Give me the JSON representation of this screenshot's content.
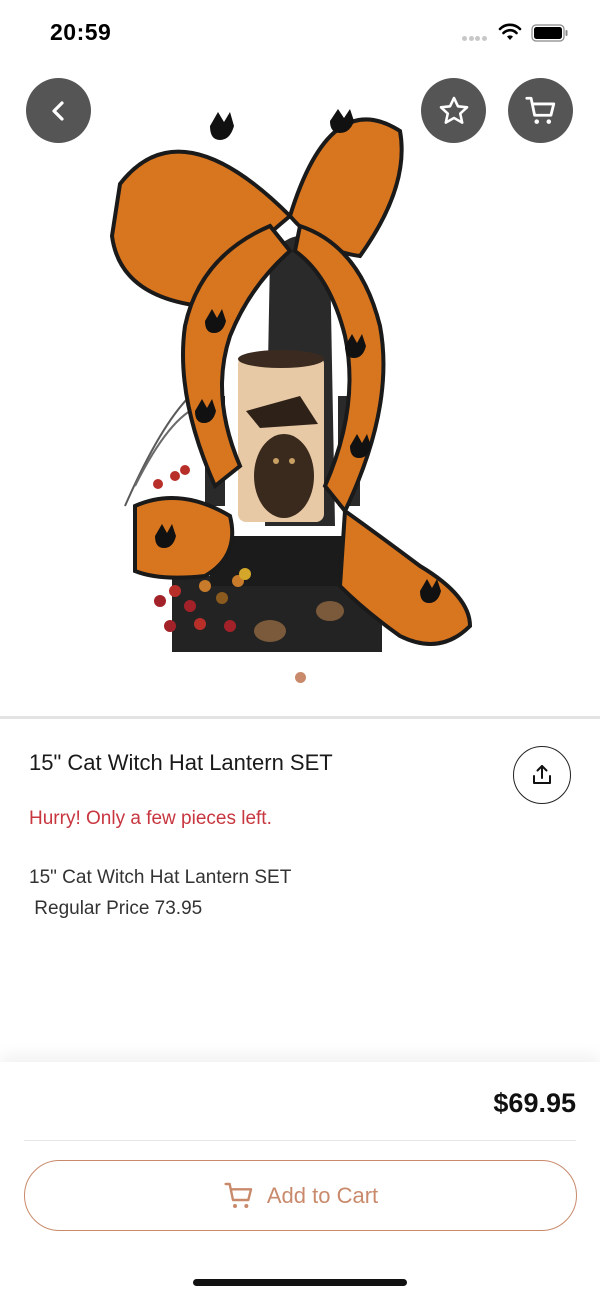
{
  "status_bar": {
    "time": "20:59"
  },
  "product": {
    "title": "15\" Cat Witch Hat Lantern SET",
    "stock_alert": "Hurry! Only a few pieces left.",
    "description": "15\" Cat Witch Hat Lantern SET\n Regular Price 73.95",
    "price": "$69.95",
    "image_count": 1,
    "active_image_index": 0
  },
  "actions": {
    "add_to_cart_label": "Add to Cart"
  },
  "icons": {
    "back": "chevron-left-icon",
    "favorite": "star-icon",
    "cart": "cart-icon",
    "share": "share-icon",
    "add_to_cart": "cart-icon"
  },
  "colors": {
    "accent": "#c98a6c",
    "alert": "#c8363f",
    "overlay_button": "#555555",
    "ribbon_orange": "#d8751f"
  }
}
